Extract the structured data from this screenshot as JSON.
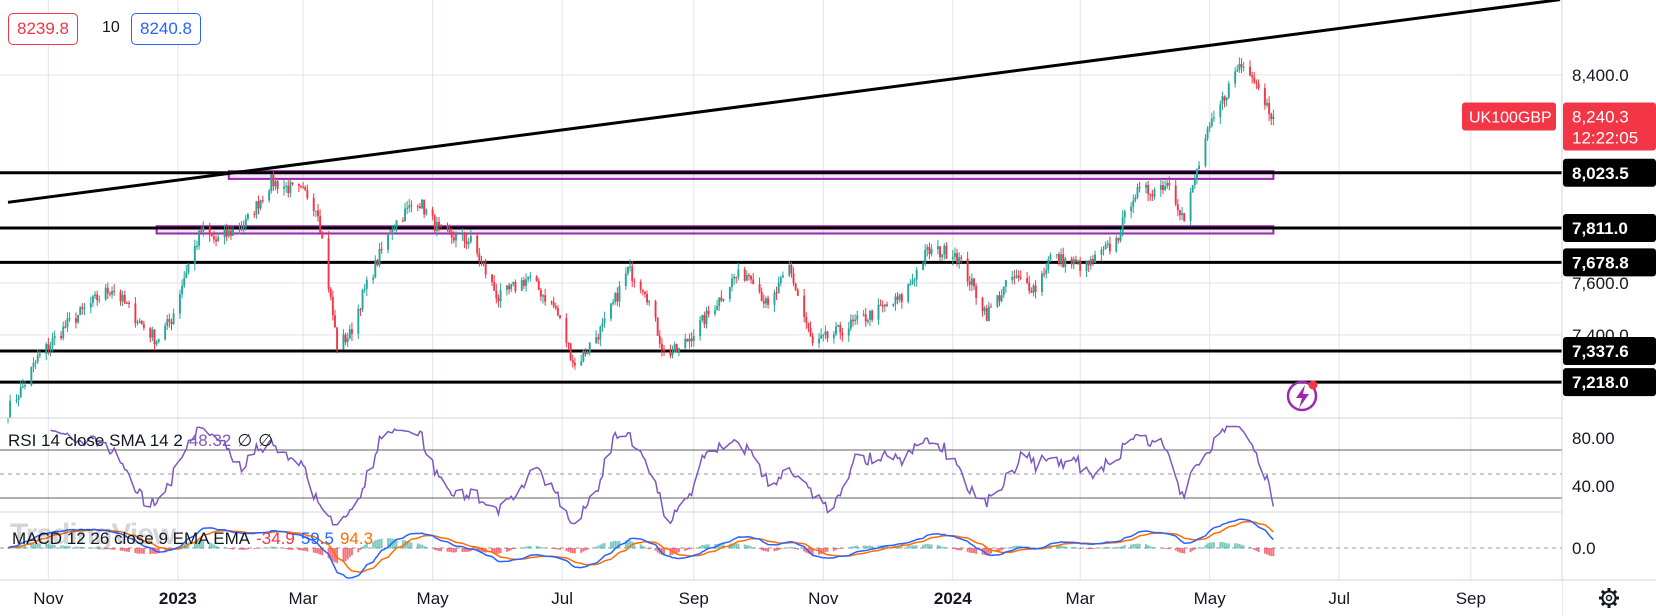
{
  "header": {
    "bid": "8239.8",
    "spread": "10",
    "ask": "8240.8"
  },
  "symbol": {
    "name": "UK100GBP",
    "price": "8,240.3",
    "countdown": "12:22:05"
  },
  "watermark": "TradingView",
  "icons": {
    "settings": "gear-icon",
    "alert": "lightning-icon"
  },
  "colors": {
    "up": "#26a69a",
    "down": "#f23645",
    "zone": "#9c27b0",
    "rsi": "#7e57c2",
    "macd": "#2962ff",
    "signal": "#ff6d00"
  },
  "chart_data": [
    {
      "type": "candlestick",
      "symbol": "UK100GBP",
      "ylim": [
        7080,
        8650
      ],
      "y_ticks": [
        "8,400.0",
        "7,600.0",
        "7,400.0"
      ],
      "x_tick_labels": [
        "Nov",
        "2023",
        "Mar",
        "May",
        "Jul",
        "Sep",
        "Nov",
        "2024",
        "Mar",
        "May",
        "Jul",
        "Sep"
      ],
      "last_price": 8240.3,
      "horizontal_levels": [
        {
          "label": "8,023.5",
          "value": 8023.5
        },
        {
          "label": "7,811.0",
          "value": 7811.0
        },
        {
          "label": "7,678.8",
          "value": 7678.8
        },
        {
          "label": "7,337.6",
          "value": 7337.6
        },
        {
          "label": "7,218.0",
          "value": 7218.0
        }
      ],
      "zones": [
        {
          "from": "2023-01-25",
          "to": "2024-05-31",
          "low": 8000,
          "high": 8030
        },
        {
          "from": "2022-12-22",
          "to": "2024-05-31",
          "low": 7790,
          "high": 7818
        }
      ],
      "trendline": [
        {
          "date": "2022-10-13",
          "value": 7910
        },
        {
          "date": "2024-10-13",
          "value": 8690
        }
      ],
      "anchors": [
        [
          "2022-10-13",
          7110
        ],
        [
          "2022-10-20",
          7200
        ],
        [
          "2022-10-27",
          7310
        ],
        [
          "2022-11-10",
          7440
        ],
        [
          "2022-11-24",
          7540
        ],
        [
          "2022-12-01",
          7580
        ],
        [
          "2022-12-15",
          7440
        ],
        [
          "2022-12-22",
          7380
        ],
        [
          "2022-12-29",
          7460
        ],
        [
          "2023-01-05",
          7650
        ],
        [
          "2023-01-12",
          7800
        ],
        [
          "2023-01-19",
          7760
        ],
        [
          "2023-02-02",
          7830
        ],
        [
          "2023-02-14",
          7990
        ],
        [
          "2023-02-24",
          7960
        ],
        [
          "2023-03-03",
          7940
        ],
        [
          "2023-03-08",
          7880
        ],
        [
          "2023-03-17",
          7360
        ],
        [
          "2023-03-23",
          7400
        ],
        [
          "2023-03-29",
          7550
        ],
        [
          "2023-04-12",
          7820
        ],
        [
          "2023-04-24",
          7920
        ],
        [
          "2023-05-05",
          7790
        ],
        [
          "2023-05-19",
          7760
        ],
        [
          "2023-06-01",
          7540
        ],
        [
          "2023-06-15",
          7620
        ],
        [
          "2023-06-28",
          7500
        ],
        [
          "2023-07-07",
          7280
        ],
        [
          "2023-07-21",
          7440
        ],
        [
          "2023-08-01",
          7650
        ],
        [
          "2023-08-09",
          7580
        ],
        [
          "2023-08-18",
          7330
        ],
        [
          "2023-08-25",
          7340
        ],
        [
          "2023-09-08",
          7480
        ],
        [
          "2023-09-20",
          7620
        ],
        [
          "2023-09-28",
          7640
        ],
        [
          "2023-10-06",
          7500
        ],
        [
          "2023-10-16",
          7660
        ],
        [
          "2023-10-27",
          7360
        ],
        [
          "2023-11-10",
          7420
        ],
        [
          "2023-11-24",
          7480
        ],
        [
          "2023-12-08",
          7540
        ],
        [
          "2023-12-20",
          7720
        ],
        [
          "2024-01-02",
          7720
        ],
        [
          "2024-01-17",
          7480
        ],
        [
          "2024-01-29",
          7620
        ],
        [
          "2024-02-09",
          7580
        ],
        [
          "2024-02-16",
          7700
        ],
        [
          "2024-03-04",
          7660
        ],
        [
          "2024-03-18",
          7760
        ],
        [
          "2024-03-26",
          7940
        ],
        [
          "2024-04-05",
          7960
        ],
        [
          "2024-04-12",
          7990
        ],
        [
          "2024-04-19",
          7840
        ],
        [
          "2024-04-29",
          8150
        ],
        [
          "2024-05-08",
          8320
        ],
        [
          "2024-05-15",
          8440
        ],
        [
          "2024-05-21",
          8415
        ],
        [
          "2024-05-27",
          8300
        ],
        [
          "2024-05-31",
          8240
        ]
      ]
    },
    {
      "type": "line",
      "title": "RSI",
      "legend": [
        "RSI 14 close SMA 14 2",
        "48.32",
        "∅",
        "∅"
      ],
      "ylim": [
        20,
        95
      ],
      "y_ticks": [
        "80.00",
        "40.00"
      ],
      "bands": [
        70,
        30
      ],
      "middle": 50,
      "last_value": 48.32
    },
    {
      "type": "line",
      "title": "MACD",
      "legend": [
        "MACD 12 26 close 9 EMA EMA",
        "-34.9",
        "59.5",
        "94.3"
      ],
      "y_ticks": [
        "0.0"
      ],
      "values": {
        "histogram": -34.9,
        "macd": 59.5,
        "signal": 94.3
      }
    }
  ]
}
